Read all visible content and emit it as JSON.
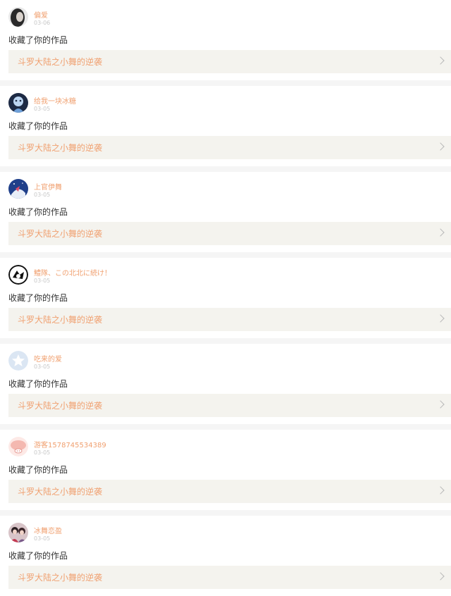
{
  "notifications": [
    {
      "username": "偏爱",
      "date": "03-06",
      "action": "收藏了你的作品",
      "work_title": "斗罗大陆之小舞的逆袭",
      "avatar": "portrait-dark-hair-icon"
    },
    {
      "username": "给我一块冰糖",
      "date": "03-05",
      "action": "收藏了你的作品",
      "work_title": "斗罗大陆之小舞的逆袭",
      "avatar": "blue-anime-character-icon"
    },
    {
      "username": "上官伊舞",
      "date": "03-05",
      "action": "收藏了你的作品",
      "work_title": "斗罗大陆之小舞的逆袭",
      "avatar": "blue-night-sky-character-icon"
    },
    {
      "username": "鱧隊、この北北に続け！",
      "date": "03-05",
      "action": "收藏了你的作品",
      "work_title": "斗罗大陆之小舞的逆袭",
      "avatar": "black-white-emblem-icon"
    },
    {
      "username": "吃来的爱",
      "date": "03-05",
      "action": "收藏了你的作品",
      "work_title": "斗罗大陆之小舞的逆袭",
      "avatar": "default-star-avatar-icon"
    },
    {
      "username": "游客1578745534389",
      "date": "03-05",
      "action": "收藏了你的作品",
      "work_title": "斗罗大陆之小舞的逆袭",
      "avatar": "pink-pig-avatar-icon"
    },
    {
      "username": "冰舞恋盈",
      "date": "03-05",
      "action": "收藏了你的作品",
      "work_title": "斗罗大陆之小舞的逆袭",
      "avatar": "two-girls-photo-icon"
    }
  ],
  "colors": {
    "username": "#f0a070",
    "work_title": "#f0a070",
    "work_bg": "#f4f3ee",
    "page_bg": "#f5f5f5"
  }
}
